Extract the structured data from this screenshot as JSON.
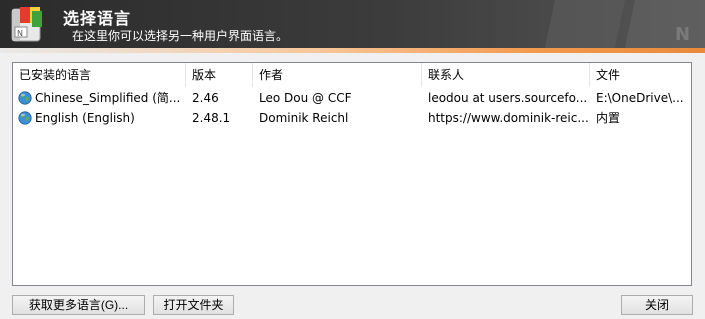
{
  "banner": {
    "title": "选择语言",
    "subtitle": "在这里你可以选择另一种用户界面语言。"
  },
  "list": {
    "columns": [
      "已安装的语言",
      "版本",
      "作者",
      "联系人",
      "文件"
    ],
    "rows": [
      {
        "icon": "globe-icon",
        "language": "Chinese_Simplified (简...",
        "version": "2.46",
        "author": "Leo Dou @ CCF",
        "contact": "leodou at users.sourcefo...",
        "file": "E:\\OneDrive\\..."
      },
      {
        "icon": "globe-icon",
        "language": "English (English)",
        "version": "2.48.1",
        "author": "Dominik Reichl",
        "contact": "https://www.dominik-reic...",
        "file": "内置"
      }
    ]
  },
  "buttons": {
    "get_more": "获取更多语言(G)...",
    "open_folder": "打开文件夹",
    "close": "关闭"
  }
}
